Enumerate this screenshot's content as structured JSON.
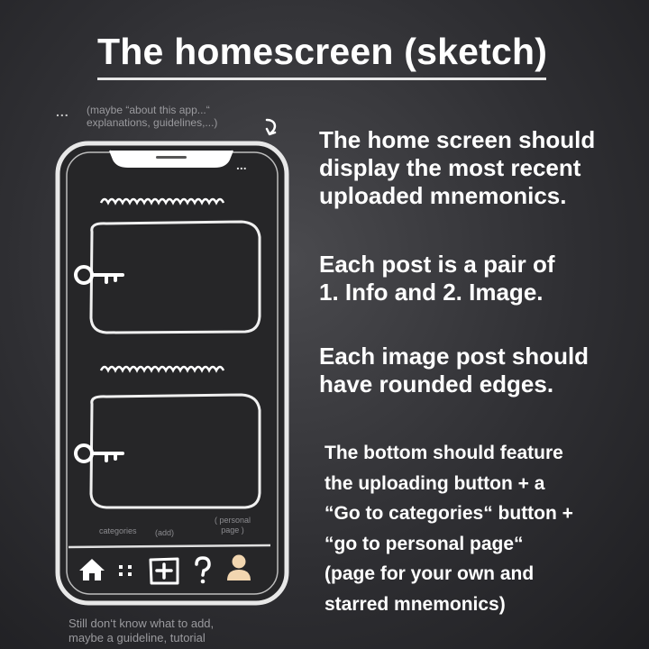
{
  "title": "The homescreen (sketch)",
  "top_note": {
    "ellipsis": "...",
    "line1": "(maybe “about this app...“",
    "line2": "explanations, guidelines,...)"
  },
  "phone": {
    "menu_dots": "...",
    "labels": {
      "categories": "categories",
      "add": "(add)",
      "personal_line1": "( personal",
      "personal_line2": "page )"
    },
    "nav_icons": [
      "home-icon",
      "categories-grid-icon",
      "add-icon",
      "help-icon",
      "user-icon"
    ],
    "user_icon_color": "#f2d6b0"
  },
  "description": {
    "p1": [
      "The home screen should",
      "display the most recent",
      "uploaded mnemonics."
    ],
    "p2": [
      "Each post is a pair of",
      "1. Info and 2. Image."
    ],
    "p3": [
      "Each image post should",
      "have rounded edges."
    ],
    "p4": [
      "The bottom should feature",
      "the uploading button + a",
      "“Go to categories“ button +",
      "“go to personal page“",
      "(page for your own and",
      "starred mnemonics)"
    ]
  },
  "bottom_note": {
    "line1": "Still don‘t know what to add,",
    "line2": "maybe a guideline, tutorial"
  }
}
